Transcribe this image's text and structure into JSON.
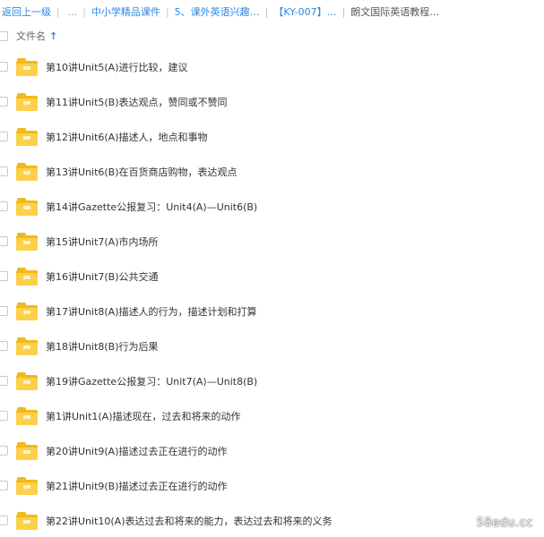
{
  "breadcrumb": {
    "items": [
      {
        "label": "返回上一级",
        "current": false
      },
      {
        "label": "中小学精品课件",
        "current": false
      },
      {
        "label": "5、课外英语兴趣…",
        "current": false
      },
      {
        "label": "【KY-007】…",
        "current": false
      },
      {
        "label": "朗文国际英语教程…",
        "current": true
      }
    ],
    "ellipsis": "...",
    "separator": "|"
  },
  "header": {
    "column_label": "文件名",
    "sort_arrow": "↑"
  },
  "files": [
    {
      "name": "第10讲Unit5(A)进行比较，建议"
    },
    {
      "name": "第11讲Unit5(B)表达观点，赞同或不赞同"
    },
    {
      "name": "第12讲Unit6(A)描述人，地点和事物"
    },
    {
      "name": "第13讲Unit6(B)在百货商店购物，表达观点"
    },
    {
      "name": "第14讲Gazette公报复习：Unit4(A)—Unit6(B)"
    },
    {
      "name": "第15讲Unit7(A)市内场所"
    },
    {
      "name": "第16讲Unit7(B)公共交通"
    },
    {
      "name": "第17讲Unit8(A)描述人的行为，描述计划和打算"
    },
    {
      "name": "第18讲Unit8(B)行为后果"
    },
    {
      "name": "第19讲Gazette公报复习：Unit7(A)—Unit8(B)"
    },
    {
      "name": "第1讲Unit1(A)描述现在，过去和将来的动作"
    },
    {
      "name": "第20讲Unit9(A)描述过去正在进行的动作"
    },
    {
      "name": "第21讲Unit9(B)描述过去正在进行的动作"
    },
    {
      "name": "第22讲Unit10(A)表达过去和将来的能力，表达过去和将来的义务"
    }
  ],
  "watermark": "58edu.cc",
  "colors": {
    "link": "#2b88e6",
    "folder_front": "#fcd04b",
    "folder_back": "#f1b91a",
    "text": "#333333"
  }
}
